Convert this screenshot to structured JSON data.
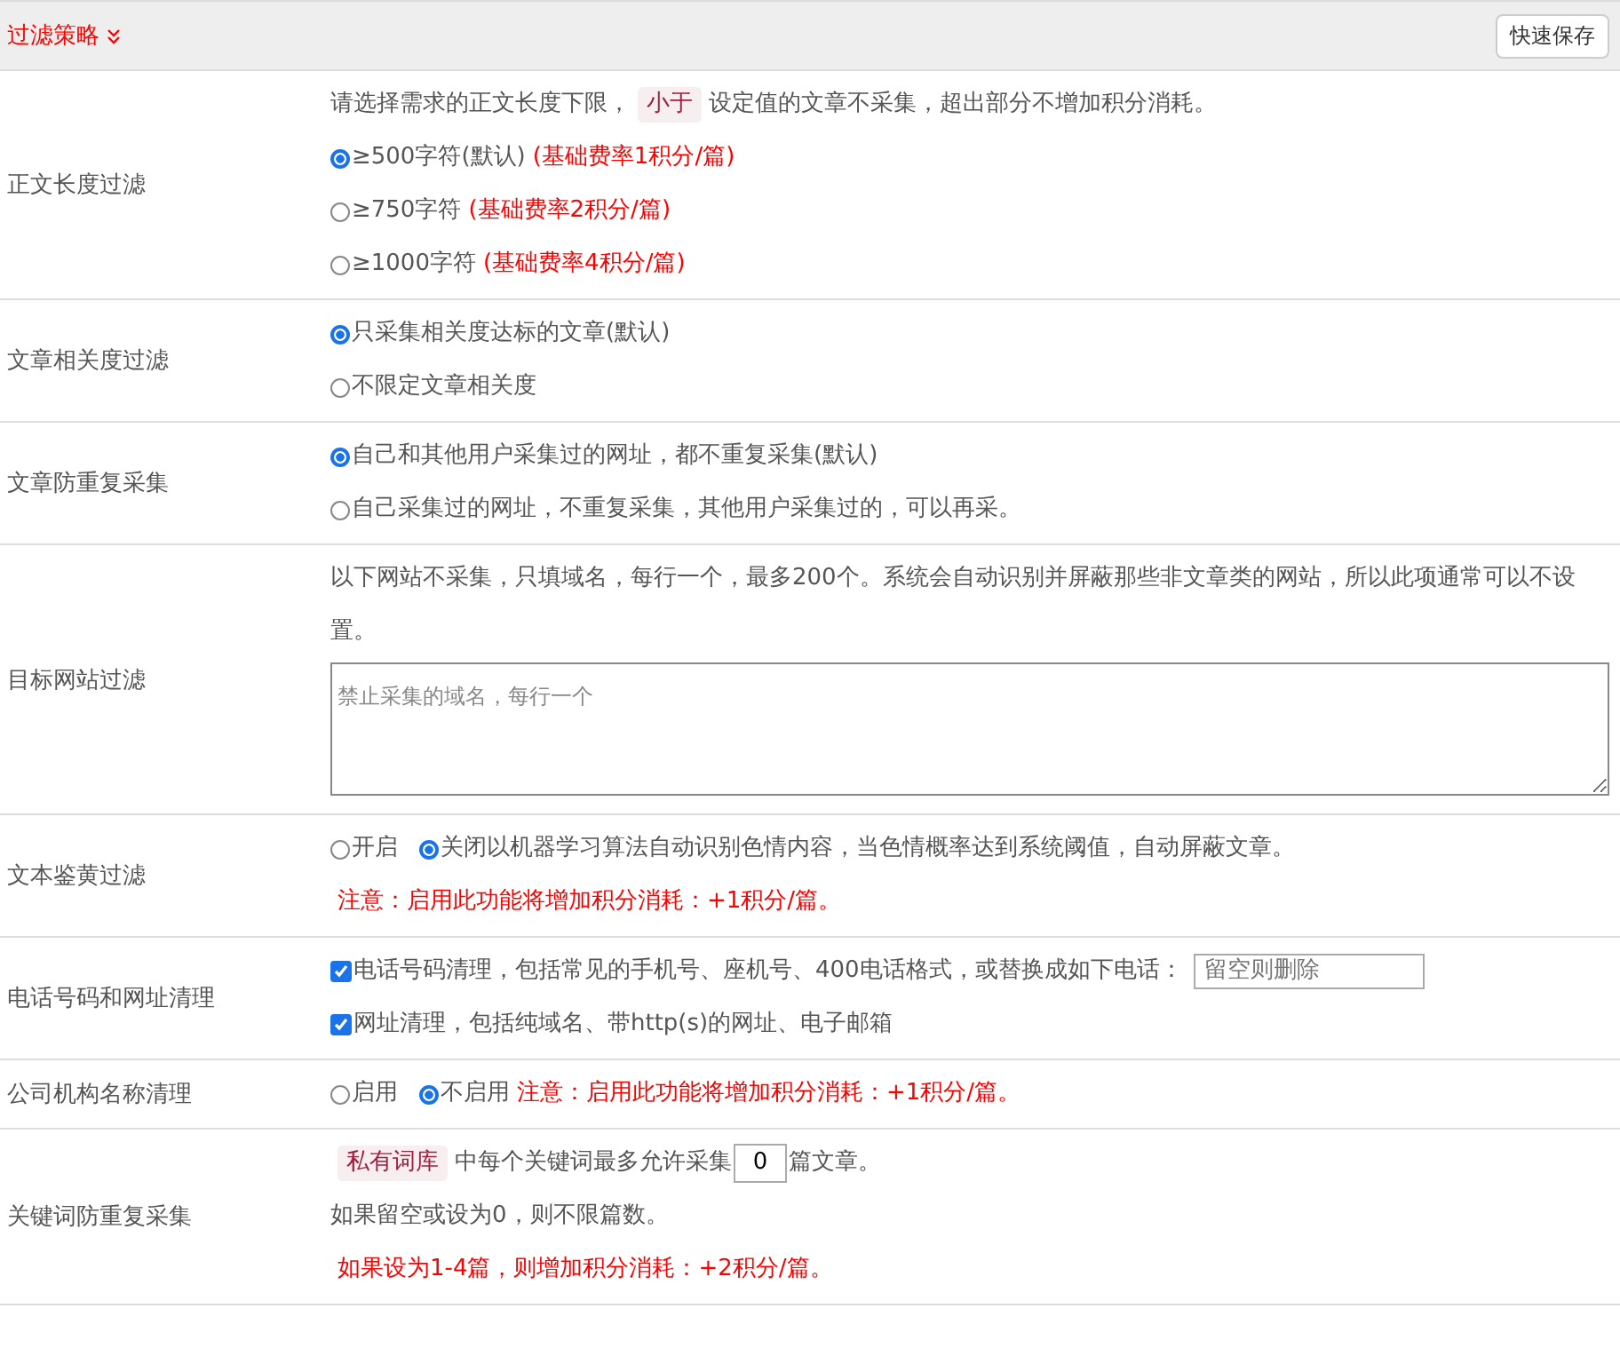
{
  "header": {
    "title": "过滤策略",
    "save_button": "快速保存"
  },
  "rows": [
    {
      "label": "正文长度过滤",
      "lines": [
        [
          {
            "kind": "text",
            "text": "请选择需求的正文长度下限，"
          },
          {
            "kind": "tag",
            "text": "小于"
          },
          {
            "kind": "text",
            "text": "设定值的文章不采集，超出部分不增加积分消耗。"
          }
        ],
        [
          {
            "kind": "radio",
            "text": "≥500字符(默认)",
            "selected": true
          },
          {
            "kind": "warning",
            "text": "(基础费率1积分/篇)"
          }
        ],
        [
          {
            "kind": "radio",
            "text": "≥750字符",
            "selected": false
          },
          {
            "kind": "warning",
            "text": "(基础费率2积分/篇)"
          }
        ],
        [
          {
            "kind": "radio",
            "text": "≥1000字符",
            "selected": false
          },
          {
            "kind": "warning",
            "text": "(基础费率4积分/篇)"
          }
        ]
      ]
    },
    {
      "label": "文章相关度过滤",
      "lines": [
        [
          {
            "kind": "radio",
            "text": "只采集相关度达标的文章(默认)",
            "selected": true
          }
        ],
        [
          {
            "kind": "radio",
            "text": "不限定文章相关度",
            "selected": false
          }
        ]
      ]
    },
    {
      "label": "文章防重复采集",
      "lines": [
        [
          {
            "kind": "radio",
            "text": "自己和其他用户采集过的网址，都不重复采集(默认)",
            "selected": true
          }
        ],
        [
          {
            "kind": "radio",
            "text": "自己采集过的网址，不重复采集，其他用户采集过的，可以再采。",
            "selected": false
          }
        ]
      ]
    },
    {
      "label": "目标网站过滤",
      "lines": [
        [
          {
            "kind": "text",
            "text": "以下网站不采集，只填域名，每行一个，最多200个。系统会自动识别并屏蔽那些非文章类的网站，所以此项通常可以不设置。"
          }
        ],
        [
          {
            "kind": "textarea",
            "placeholder": "禁止采集的域名，每行一个"
          }
        ]
      ]
    },
    {
      "label": "文本鉴黄过滤",
      "lines": [
        [
          {
            "kind": "radio",
            "text": "开启",
            "selected": false
          },
          {
            "kind": "radio",
            "text": "关闭",
            "selected": true
          },
          {
            "kind": "text",
            "text": "以机器学习算法自动识别色情内容，当色情概率达到系统阈值，自动屏蔽文章。"
          }
        ],
        [
          {
            "kind": "warning",
            "text": "注意：启用此功能将增加积分消耗：+1积分/篇。"
          }
        ]
      ]
    },
    {
      "label": "电话号码和网址清理",
      "lines": [
        [
          {
            "kind": "checkbox",
            "text": "电话号码清理，包括常见的手机号、座机号、400电话格式，或替换成如下电话：",
            "checked": true
          },
          {
            "kind": "input",
            "placeholder": "留空则删除"
          }
        ],
        [
          {
            "kind": "checkbox",
            "text": "网址清理，包括纯域名、带http(s)的网址、电子邮箱",
            "checked": true
          }
        ]
      ]
    },
    {
      "label": "公司机构名称清理",
      "lines": [
        [
          {
            "kind": "radio",
            "text": "启用",
            "selected": false
          },
          {
            "kind": "radio",
            "text": "不启用",
            "selected": true
          },
          {
            "kind": "warning",
            "text": "注意：启用此功能将增加积分消耗：+1积分/篇。"
          }
        ]
      ]
    },
    {
      "label": "关键词防重复采集",
      "lines": [
        [
          {
            "kind": "tag",
            "text": "私有词库"
          },
          {
            "kind": "text",
            "text": "中每个关键词最多允许采集"
          },
          {
            "kind": "number",
            "value": "0"
          },
          {
            "kind": "text",
            "text": "篇文章。"
          }
        ],
        [
          {
            "kind": "text",
            "text": "如果留空或设为0，则不限篇数。"
          }
        ],
        [
          {
            "kind": "warning",
            "text": "如果设为1-4篇，则增加积分消耗：+2积分/篇。"
          }
        ]
      ]
    }
  ]
}
